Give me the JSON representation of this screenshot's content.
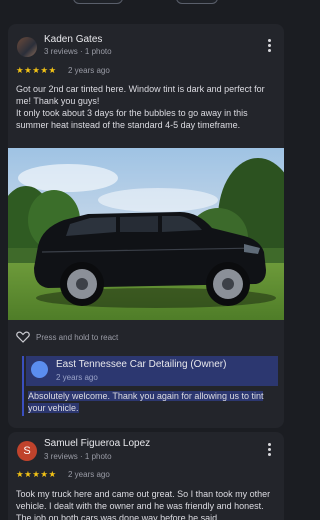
{
  "reviews": [
    {
      "author": "Kaden Gates",
      "meta": "3 reviews · 1 photo",
      "stars": "★★★★★",
      "time": "2 years ago",
      "text_line1": "Got our 2nd car tinted here. Window tint is dark and perfect for me! Thank you guys!",
      "text_line2": "It only took about 3 days for the bubbles to go away in this summer heat instead of the standard 4-5 day timeframe.",
      "react_label": "Press and hold to react",
      "owner_reply": {
        "author": "East Tennessee Car Detailing (Owner)",
        "time": "2 years ago",
        "text": "Absolutely welcome. Thank you again for allowing us to tint your vehicle."
      }
    },
    {
      "author": "Samuel Figueroa Lopez",
      "avatar_letter": "S",
      "meta": "3 reviews · 1 photo",
      "stars": "★★★★★",
      "time": "2 years ago",
      "text": "Took my truck here and came out great. So I than took my other vehicle. I dealt with the owner and he was friendly and honest. The job on both cars was done way before he said"
    }
  ],
  "colors": {
    "background": "#1b1d22",
    "card": "#23252b",
    "star": "#f3c316",
    "reply_highlight": "#2c3770",
    "reply_avatar": "#5b8def",
    "avatar_s": "#c0432c"
  },
  "icons": [
    "kebab-menu-icon",
    "heart-outline-icon",
    "store-avatar-icon"
  ]
}
